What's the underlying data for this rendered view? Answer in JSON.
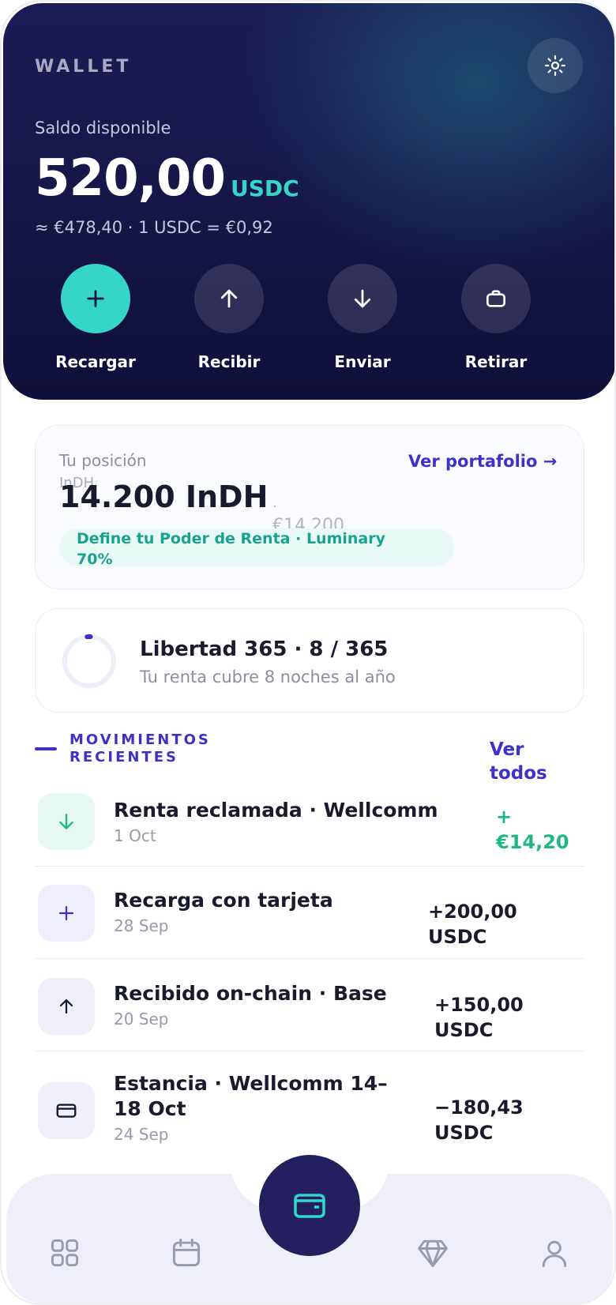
{
  "header": {
    "title": "WALLET",
    "balance_label": "Saldo disponible",
    "balance": "520,00",
    "currency": "USDC",
    "rate": "≈ €478,40 · 1 USDC = €0,92"
  },
  "actions": [
    {
      "label": "Recargar",
      "icon": "plus-icon"
    },
    {
      "label": "Recibir",
      "icon": "arrow-up-icon"
    },
    {
      "label": "Enviar",
      "icon": "arrow-down-icon"
    },
    {
      "label": "Retirar",
      "icon": "briefcase-icon"
    }
  ],
  "position": {
    "label": "Tu posición",
    "label2": "InDH",
    "value": "14.200 InDH",
    "separator": "·",
    "eur_value": "€14.200",
    "link": "Ver portafolio →",
    "pill": "Define tu Poder de Renta · Luminary 70%"
  },
  "libertad": {
    "title": "Libertad 365 · 8 / 365",
    "subtitle": "Tu renta cubre 8 noches al año",
    "progress": 0.022
  },
  "movements": {
    "title": "MOVIMIENTOS RECIENTES",
    "link": "Ver todos",
    "items": [
      {
        "name": "Renta reclamada · Wellcomm",
        "date": "1 Oct",
        "amount": "+ €14,20",
        "icon": "arrow-down-icon"
      },
      {
        "name": "Recarga con tarjeta",
        "date": "28 Sep",
        "amount": "+200,00 USDC",
        "icon": "plus-icon"
      },
      {
        "name": "Recibido on-chain · Base",
        "date": "20 Sep",
        "amount": "+150,00 USDC",
        "icon": "arrow-up-icon"
      },
      {
        "name": "Estancia · Wellcomm 14–18 Oct",
        "date": "24 Sep",
        "amount": "−180,43 USDC",
        "icon": "card-icon"
      }
    ]
  },
  "nav": {
    "items": [
      "grid-icon",
      "calendar-icon",
      "wallet-icon",
      "diamond-icon",
      "user-icon"
    ],
    "active": "wallet-icon"
  },
  "colors": {
    "accent": "#35d6c7",
    "primary": "#3b32c8",
    "hero": "#151545",
    "positive": "#1fb884"
  }
}
